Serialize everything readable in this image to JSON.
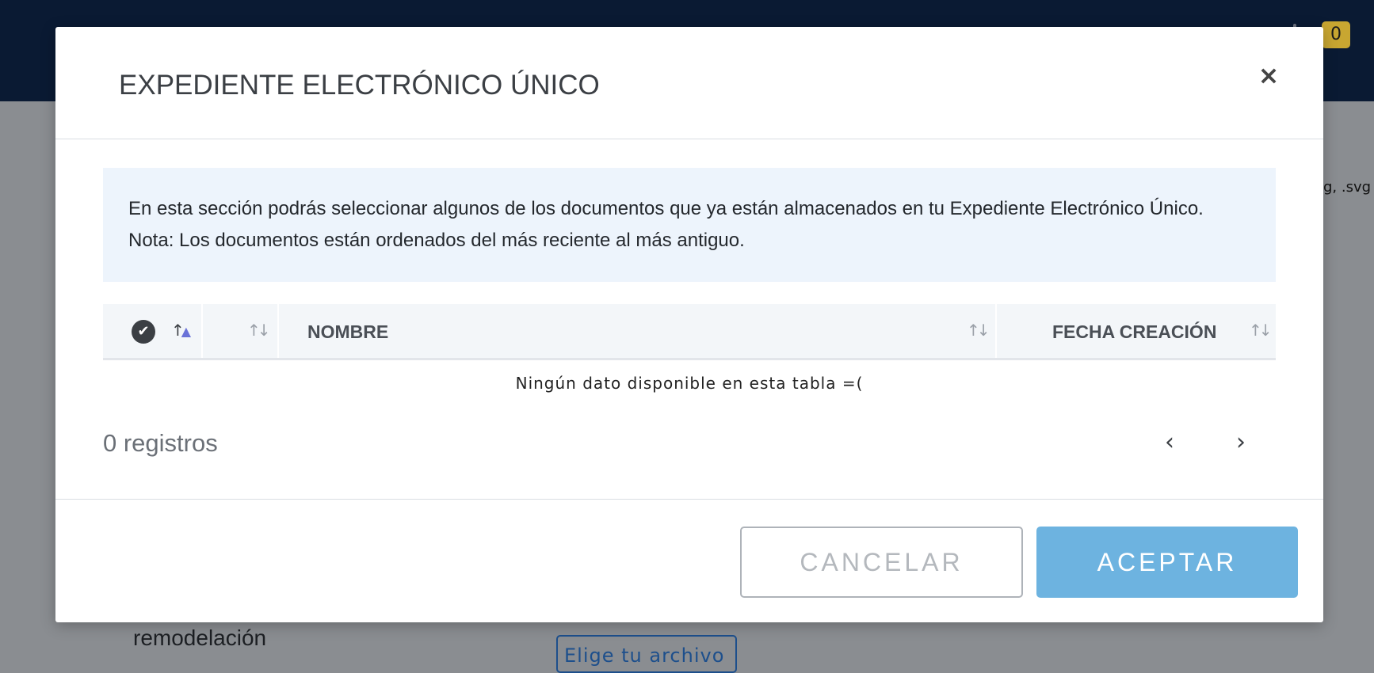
{
  "background": {
    "cart_count": "0",
    "side_text": "g, .svg",
    "remodel_label": "remodelación",
    "file_button_label": "Elige tu archivo"
  },
  "modal": {
    "title": "EXPEDIENTE ELECTRÓNICO ÚNICO",
    "close_label": "×",
    "info": {
      "line1": "En esta sección podrás seleccionar algunos de los documentos que ya están almacenados en tu Expediente Electrónico Único.",
      "line2": "Nota: Los documentos están ordenados del más reciente al más antiguo."
    },
    "table": {
      "columns": [
        "",
        "",
        "NOMBRE",
        "FECHA CREACIÓN"
      ],
      "rows": [],
      "empty_message": "Ningún dato disponible en esta tabla =("
    },
    "record_count": "0 registros",
    "pager": {
      "prev_label": "‹",
      "next_label": "›"
    },
    "footer": {
      "cancel_label": "CANCELAR",
      "accept_label": "ACEPTAR"
    }
  },
  "colors": {
    "header_bg": "#0a1a33",
    "overlay_bg": "#8a8d91",
    "info_bg": "#edf4fc",
    "accept_bg": "#6db3e0",
    "badge_bg": "#c8a631"
  },
  "icons": {
    "check": "check-circle-icon",
    "sort": "sort-arrows-icon",
    "close": "close-icon",
    "prev": "chevron-left-icon",
    "next": "chevron-right-icon"
  }
}
